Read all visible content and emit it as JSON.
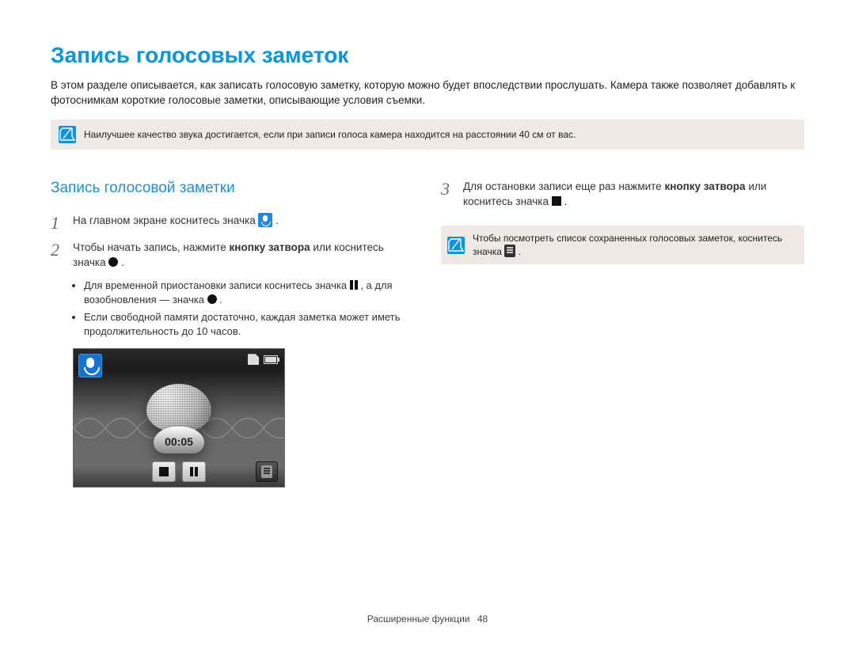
{
  "title": "Запись голосовых заметок",
  "intro": "В этом разделе описывается, как записать голосовую заметку, которую можно будет впоследствии прослушать. Камера также позволяет добавлять к фотоснимкам короткие голосовые заметки, описывающие условия съемки.",
  "note_top": "Наилучшее качество звука достигается, если при записи голоса камера находится на расстоянии 40 см от вас.",
  "section_title": "Запись голосовой заметки",
  "steps": {
    "s1_num": "1",
    "s1_body_a": "На главном экране коснитесь значка ",
    "s1_body_b": ".",
    "s2_num": "2",
    "s2_body_a": "Чтобы начать запись, нажмите ",
    "s2_body_bold": "кнопку затвора",
    "s2_body_b": " или коснитесь значка ",
    "s2_body_c": ".",
    "s3_num": "3",
    "s3_body_a": "Для остановки записи еще раз нажмите ",
    "s3_body_bold": "кнопку затвора",
    "s3_body_b": " или коснитесь значка ",
    "s3_body_c": "."
  },
  "bullets": {
    "b1_a": "Для временной приостановки записи коснитесь значка ",
    "b1_b": ", а для возобновления — значка ",
    "b1_c": ".",
    "b2": "Если свободной памяти достаточно, каждая заметка может иметь продолжительность до 10 часов."
  },
  "note_right_a": "Чтобы посмотреть список сохраненных голосовых заметок, коснитесь значка ",
  "note_right_b": ".",
  "device": {
    "timer": "00:05"
  },
  "footer": {
    "section": "Расширенные функции",
    "page": "48"
  }
}
